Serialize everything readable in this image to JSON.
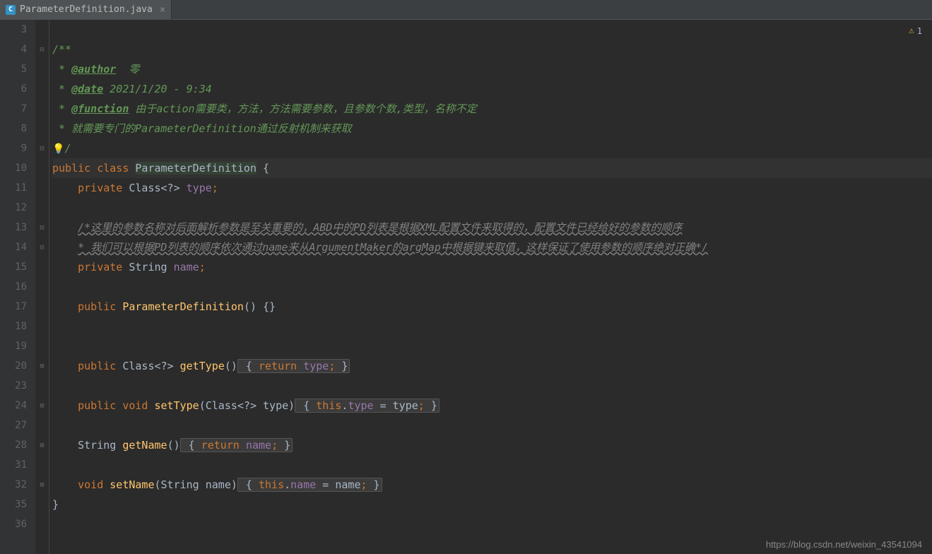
{
  "tab": {
    "icon_letter": "C",
    "filename": "ParameterDefinition.java",
    "close": "×"
  },
  "warning": {
    "icon": "⚠",
    "count": "1"
  },
  "gutter": {
    "lines": [
      "3",
      "4",
      "5",
      "6",
      "7",
      "8",
      "9",
      "10",
      "11",
      "12",
      "13",
      "14",
      "15",
      "16",
      "17",
      "18",
      "19",
      "20",
      "23",
      "24",
      "27",
      "28",
      "31",
      "32",
      "35",
      "36"
    ]
  },
  "bulb": "💡",
  "code": {
    "l1": "/**",
    "l2_star": " * ",
    "l2_tag": "@author",
    "l2_text": "  零",
    "l3_star": " * ",
    "l3_tag": "@date",
    "l3_text": " 2021/1/20 - 9:34",
    "l4_star": " * ",
    "l4_tag": "@function",
    "l4_text": " 由于action需要类，方法，方法需要参数，且参数个数,类型，名称不定",
    "l5_star": " * ",
    "l5_text": "就需要专门的ParameterDefinition通过反射机制来获取",
    "l6": " */",
    "l7_kw1": "public ",
    "l7_kw2": "class ",
    "l7_name": "ParameterDefinition",
    "l7_brace": " {",
    "l8_kw": "private ",
    "l8_type": "Class<?> ",
    "l8_field": "type",
    "l8_semi": ";",
    "l10_c1": "/*这里的参数名称对后面解析参数是至关重要的，ABD中的PD列表是根据XML配置文件来取得的，配置文件已经给好的参数的顺序",
    "l11_c1": "* 我们可以根据PD列表的顺序依次通过name来从ArgumentMaker的argMap中根据键来取值，这样保证了使用参数的顺序绝对正确*/",
    "l12_kw": "private ",
    "l12_type": "String ",
    "l12_field": "name",
    "l12_semi": ";",
    "l14_kw": "public ",
    "l14_name": "ParameterDefinition",
    "l14_rest": "() {}",
    "l17_kw": "public ",
    "l17_type": "Class<?> ",
    "l17_method": "getType",
    "l17_paren": "()",
    "l17_brace1": " { ",
    "l17_ret": "return ",
    "l17_field": "type",
    "l17_semi": ";",
    "l17_brace2": " }",
    "l20_kw1": "public ",
    "l20_kw2": "void ",
    "l20_method": "setType",
    "l20_paren1": "(",
    "l20_ptype": "Class<?> ",
    "l20_pname": "type",
    "l20_paren2": ")",
    "l20_brace1": " { ",
    "l20_this": "this",
    "l20_dot": ".",
    "l20_field": "type",
    "l20_eq": " = ",
    "l20_param": "type",
    "l20_semi": ";",
    "l20_brace2": " }",
    "l23_type": "String ",
    "l23_method": "getName",
    "l23_paren": "()",
    "l23_brace1": " { ",
    "l23_ret": "return ",
    "l23_field": "name",
    "l23_semi": ";",
    "l23_brace2": " }",
    "l26_kw": "void ",
    "l26_method": "setName",
    "l26_paren1": "(",
    "l26_ptype": "String ",
    "l26_pname": "name",
    "l26_paren2": ")",
    "l26_brace1": " { ",
    "l26_this": "this",
    "l26_dot": ".",
    "l26_field": "name",
    "l26_eq": " = ",
    "l26_param": "name",
    "l26_semi": ";",
    "l26_brace2": " }",
    "l28_brace": "}"
  },
  "watermark": "https://blog.csdn.net/weixin_43541094"
}
